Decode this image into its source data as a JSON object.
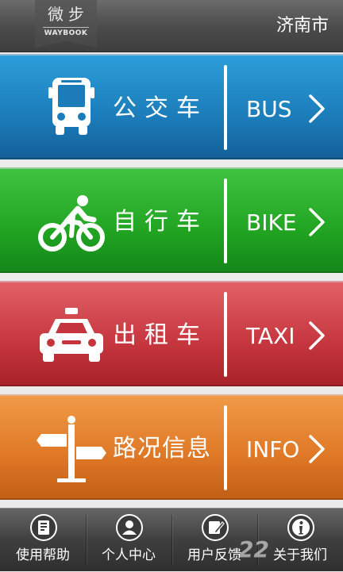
{
  "header": {
    "logo_cn": "微步",
    "logo_en": "WAYBOOK",
    "city": "济南市"
  },
  "tiles": [
    {
      "label": "公交车",
      "en": "BUS",
      "icon": "bus-icon",
      "color": "#1b7cb9"
    },
    {
      "label": "自行车",
      "en": "BIKE",
      "icon": "bike-icon",
      "color": "#21a421"
    },
    {
      "label": "出租车",
      "en": "TAXI",
      "icon": "taxi-icon",
      "color": "#c5353d"
    },
    {
      "label": "路况信息",
      "en": "INFO",
      "icon": "signpost-icon",
      "color": "#de7725"
    }
  ],
  "nav": [
    {
      "label": "使用帮助",
      "icon": "help-book-icon"
    },
    {
      "label": "个人中心",
      "icon": "user-icon"
    },
    {
      "label": "用户反馈",
      "icon": "feedback-icon"
    },
    {
      "label": "关于我们",
      "icon": "info-icon"
    }
  ],
  "watermark": "22"
}
